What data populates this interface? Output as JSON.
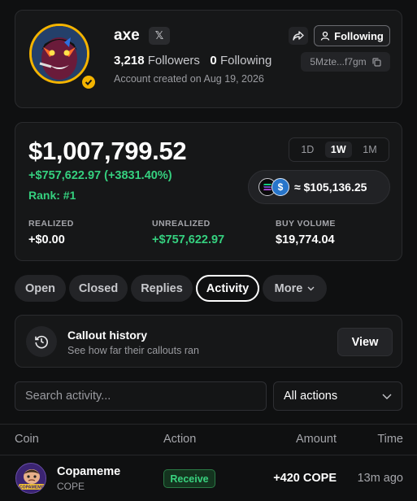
{
  "profile": {
    "name": "axe",
    "x_label": "𝕏",
    "followers_count": "3,218",
    "followers_label": "Followers",
    "following_count": "0",
    "following_label": "Following",
    "created": "Account created on Aug 19, 2026",
    "follow_button": "Following",
    "address": "5Mzte...f7gm"
  },
  "pnl": {
    "total": "$1,007,799.52",
    "change": "+$757,622.97 (+3831.40%)",
    "rank": "Rank: #1",
    "periods": [
      "1D",
      "1W",
      "1M"
    ],
    "active_period": "1W",
    "balance": "≈ $105,136.25",
    "metrics": [
      {
        "label": "REALIZED",
        "value": "+$0.00"
      },
      {
        "label": "UNREALIZED",
        "value": "+$757,622.97"
      },
      {
        "label": "BUY VOLUME",
        "value": "$19,774.04"
      }
    ]
  },
  "tabs": [
    "Open",
    "Closed",
    "Replies",
    "Activity",
    "More"
  ],
  "active_tab": "Activity",
  "callout": {
    "title": "Callout history",
    "subtitle": "See how far their callouts ran",
    "button": "View"
  },
  "filters": {
    "search_placeholder": "Search activity...",
    "action_select": "All actions"
  },
  "table": {
    "columns": [
      "Coin",
      "Action",
      "Amount",
      "Time"
    ],
    "rows": [
      {
        "coin_name": "Copameme",
        "coin_symbol": "COPE",
        "coin_logo_text": "COPAMEME",
        "action": "Receive",
        "amount": "+420 COPE",
        "time": "13m ago"
      }
    ]
  },
  "colors": {
    "background": "#0f1011",
    "card": "#161718",
    "positive": "#35d07f",
    "avatar_ring": "#f4b400",
    "usdc": "#2775ca"
  }
}
